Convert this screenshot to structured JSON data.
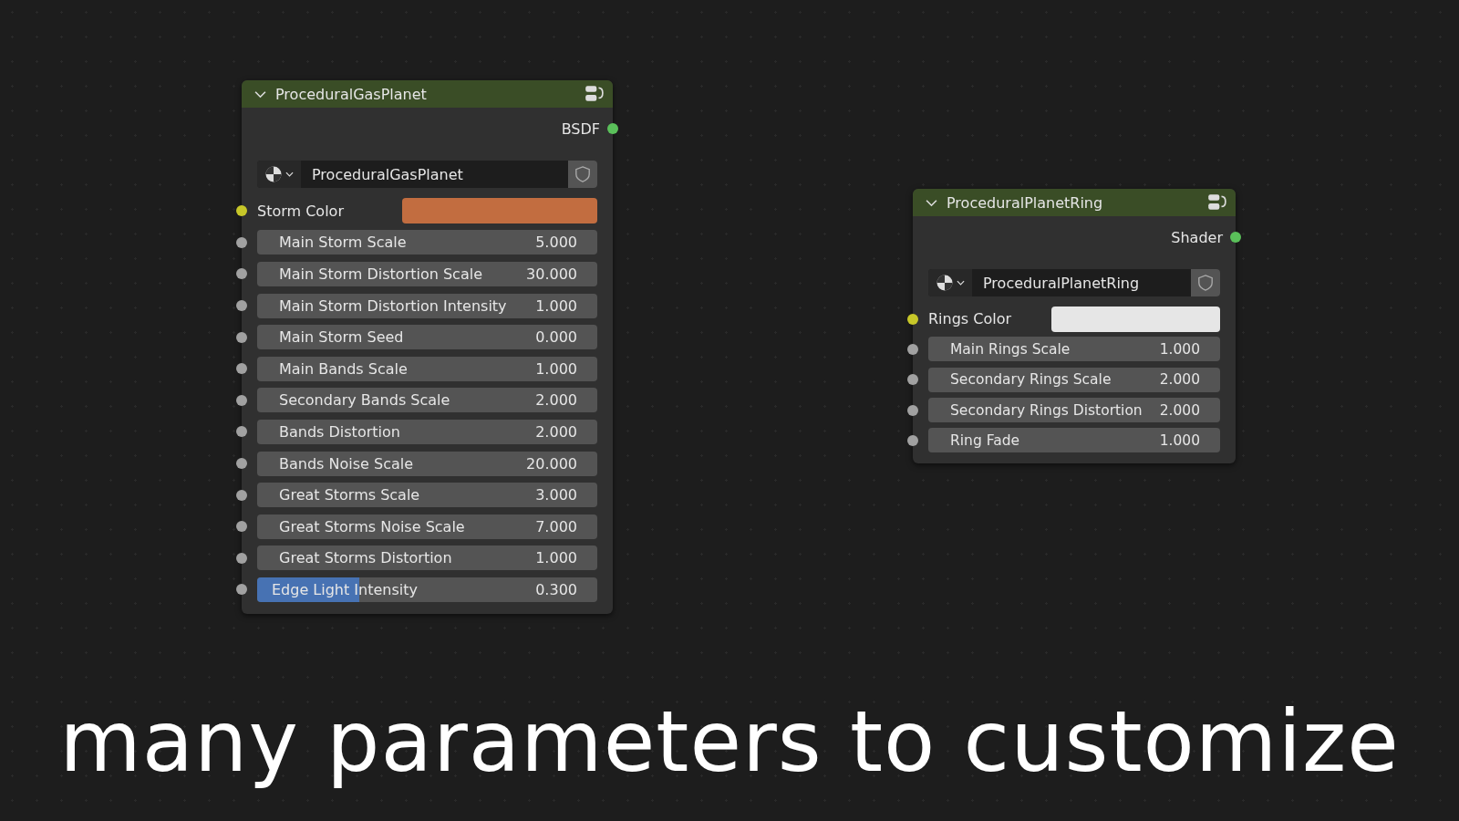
{
  "nodes": [
    {
      "title": "ProceduralGasPlanet",
      "output": "BSDF",
      "material": "ProceduralGasPlanet",
      "inputs": [
        {
          "kind": "color",
          "label": "Storm Color",
          "color": "#c26d40"
        },
        {
          "kind": "number",
          "label": "Main Storm Scale",
          "value": "5.000"
        },
        {
          "kind": "number",
          "label": "Main Storm Distortion Scale",
          "value": "30.000"
        },
        {
          "kind": "number",
          "label": "Main Storm Distortion Intensity",
          "value": "1.000"
        },
        {
          "kind": "number",
          "label": "Main Storm Seed",
          "value": "0.000"
        },
        {
          "kind": "number",
          "label": "Main Bands Scale",
          "value": "1.000"
        },
        {
          "kind": "number",
          "label": "Secondary Bands Scale",
          "value": "2.000"
        },
        {
          "kind": "number",
          "label": "Bands Distortion",
          "value": "2.000"
        },
        {
          "kind": "number",
          "label": "Bands Noise Scale",
          "value": "20.000"
        },
        {
          "kind": "number",
          "label": "Great Storms Scale",
          "value": "3.000"
        },
        {
          "kind": "number",
          "label": "Great Storms Noise Scale",
          "value": "7.000"
        },
        {
          "kind": "number",
          "label": "Great Storms Distortion",
          "value": "1.000"
        },
        {
          "kind": "slider",
          "label": "Edge Light Intensity",
          "value": "0.300",
          "level": 0.3
        }
      ]
    },
    {
      "title": "ProceduralPlanetRing",
      "output": "Shader",
      "material": "ProceduralPlanetRing",
      "inputs": [
        {
          "kind": "color",
          "label": "Rings Color",
          "color": "#e6e6e6"
        },
        {
          "kind": "number",
          "label": "Main Rings Scale",
          "value": "1.000"
        },
        {
          "kind": "number",
          "label": "Secondary Rings Scale",
          "value": "2.000"
        },
        {
          "kind": "number",
          "label": "Secondary Rings Distortion",
          "value": "2.000"
        },
        {
          "kind": "number",
          "label": "Ring Fade",
          "value": "1.000"
        }
      ]
    }
  ],
  "caption": "many parameters to customize"
}
